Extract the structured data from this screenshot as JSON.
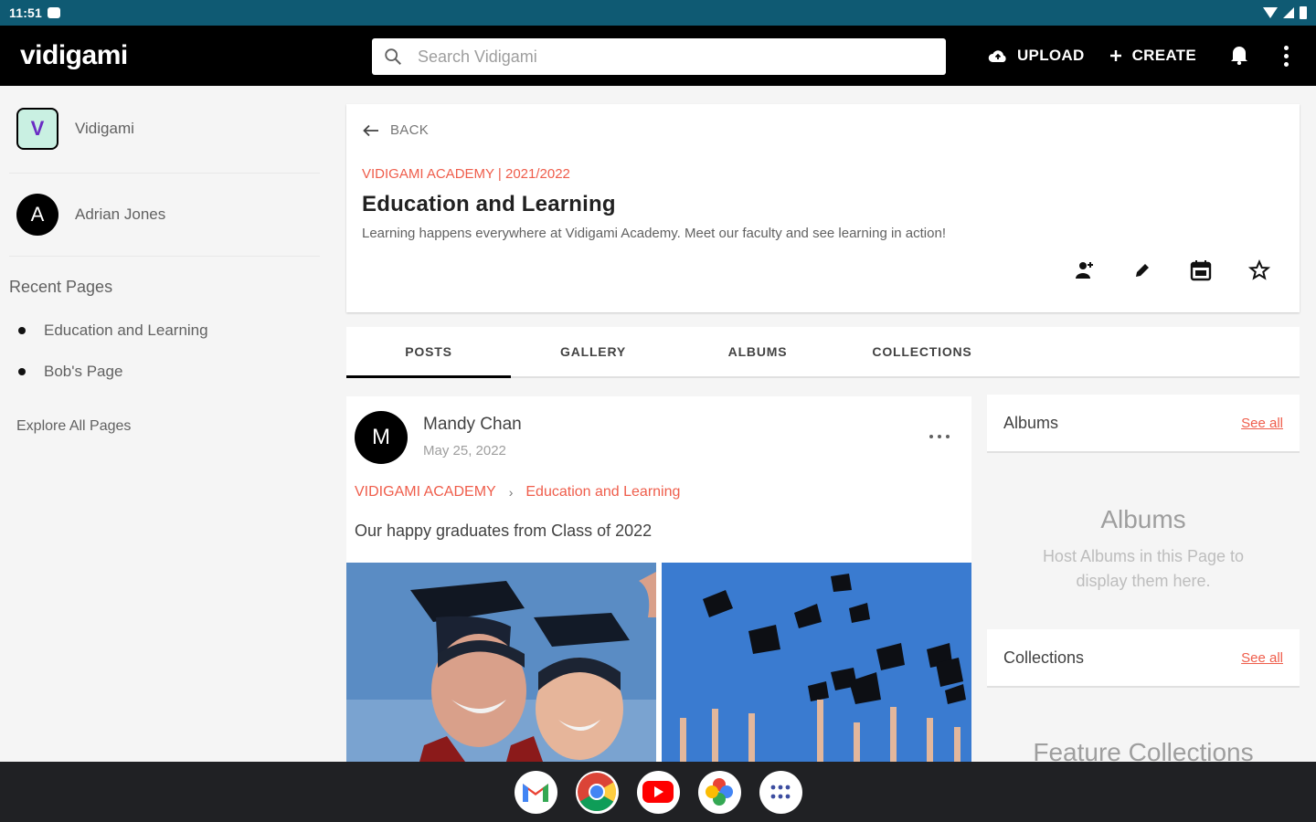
{
  "status_bar": {
    "time": "11:51"
  },
  "app_bar": {
    "logo": "vidigami",
    "search_placeholder": "Search Vidigami",
    "upload_label": "UPLOAD",
    "create_label": "CREATE"
  },
  "sidebar": {
    "org_name": "Vidigami",
    "org_initial": "V",
    "user_initial": "A",
    "user_name": "Adrian Jones",
    "recent_title": "Recent Pages",
    "recent_items": [
      "Education and Learning",
      "Bob's Page"
    ],
    "explore_label": "Explore All Pages"
  },
  "page": {
    "back_label": "BACK",
    "breadcrumb": "VIDIGAMI ACADEMY | 2021/2022",
    "title": "Education and Learning",
    "description": "Learning happens everywhere at Vidigami Academy. Meet our faculty and see learning in action!"
  },
  "tabs": [
    "POSTS",
    "GALLERY",
    "ALBUMS",
    "COLLECTIONS"
  ],
  "post": {
    "author_initial": "M",
    "author": "Mandy Chan",
    "date": "May 25, 2022",
    "crumb_org": "VIDIGAMI ACADEMY",
    "crumb_page": "Education and Learning",
    "text": "Our happy graduates from Class of 2022"
  },
  "rail": {
    "albums_label": "Albums",
    "see_all": "See all",
    "albums_empty_title": "Albums",
    "albums_empty_line1": "Host Albums in this Page to",
    "albums_empty_line2": "display them here.",
    "collections_label": "Collections",
    "feature_collections": "Feature Collections"
  },
  "colors": {
    "status_bar": "#0f5a73",
    "accent": "#ef5d4b",
    "app_bar": "#000000"
  },
  "dock_icons": [
    "gmail-icon",
    "chrome-icon",
    "youtube-icon",
    "photos-icon",
    "apps-icon"
  ]
}
